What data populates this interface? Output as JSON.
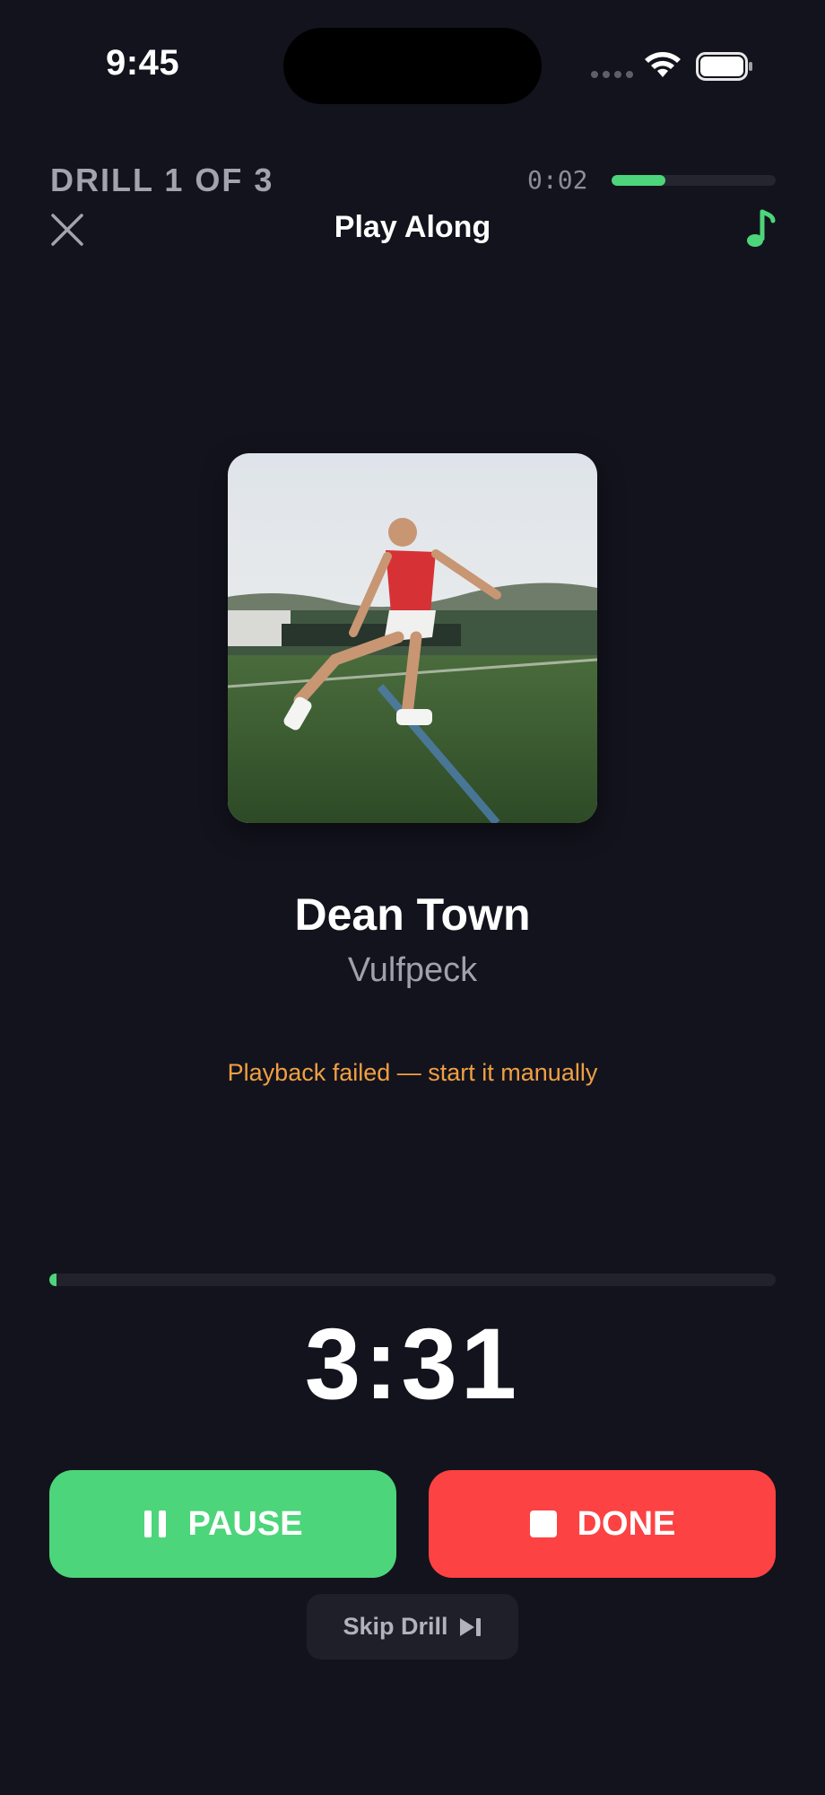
{
  "status_bar": {
    "time": "9:45"
  },
  "header": {
    "drill_label": "DRILL 1 OF 3",
    "elapsed": "0:02",
    "drill_progress_fraction": 0.33,
    "title": "Play Along"
  },
  "track": {
    "song": "Dean Town",
    "artist": "Vulfpeck",
    "error_message": "Playback failed — start it manually",
    "progress_fraction": 0.01,
    "remaining": "3:31"
  },
  "controls": {
    "pause_label": "PAUSE",
    "done_label": "DONE",
    "skip_label": "Skip Drill"
  },
  "colors": {
    "accent_green": "#4cd57a",
    "done_red": "#fc4243",
    "warning_orange": "#f0a043",
    "background": "#13131d"
  },
  "icons": [
    "close-icon",
    "music-note-icon",
    "pause-icon",
    "stop-icon",
    "skip-forward-icon",
    "wifi-icon",
    "battery-icon",
    "signal-icon"
  ]
}
